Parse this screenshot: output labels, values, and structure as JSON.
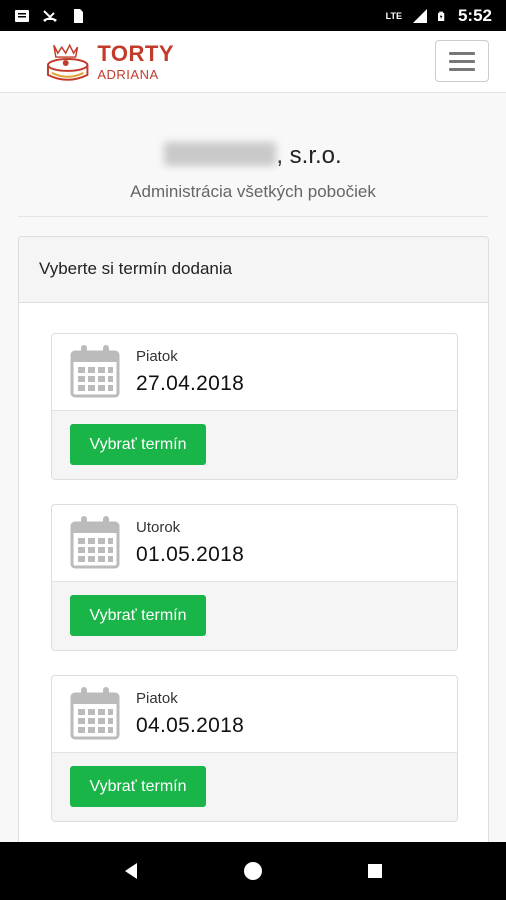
{
  "status_bar": {
    "time": "5:52",
    "network": "LTE"
  },
  "header": {
    "logo_main": "TORTY",
    "logo_sub": "ADRIANA"
  },
  "company": {
    "suffix": ", s.r.o.",
    "subtitle": "Administrácia všetkých pobočiek"
  },
  "panel": {
    "title": "Vyberte si termín dodania",
    "slots": [
      {
        "day": "Piatok",
        "date": "27.04.2018",
        "button": "Vybrať termín"
      },
      {
        "day": "Utorok",
        "date": "01.05.2018",
        "button": "Vybrať termín"
      },
      {
        "day": "Piatok",
        "date": "04.05.2018",
        "button": "Vybrať termín"
      }
    ]
  },
  "colors": {
    "accent_green": "#1ab548",
    "brand_red": "#c23b2b"
  },
  "icons": [
    "message-icon",
    "missed-call-icon",
    "sim-icon",
    "signal-icon",
    "battery-icon",
    "calendar-icon",
    "menu-icon",
    "back-icon",
    "home-icon",
    "recents-icon"
  ]
}
